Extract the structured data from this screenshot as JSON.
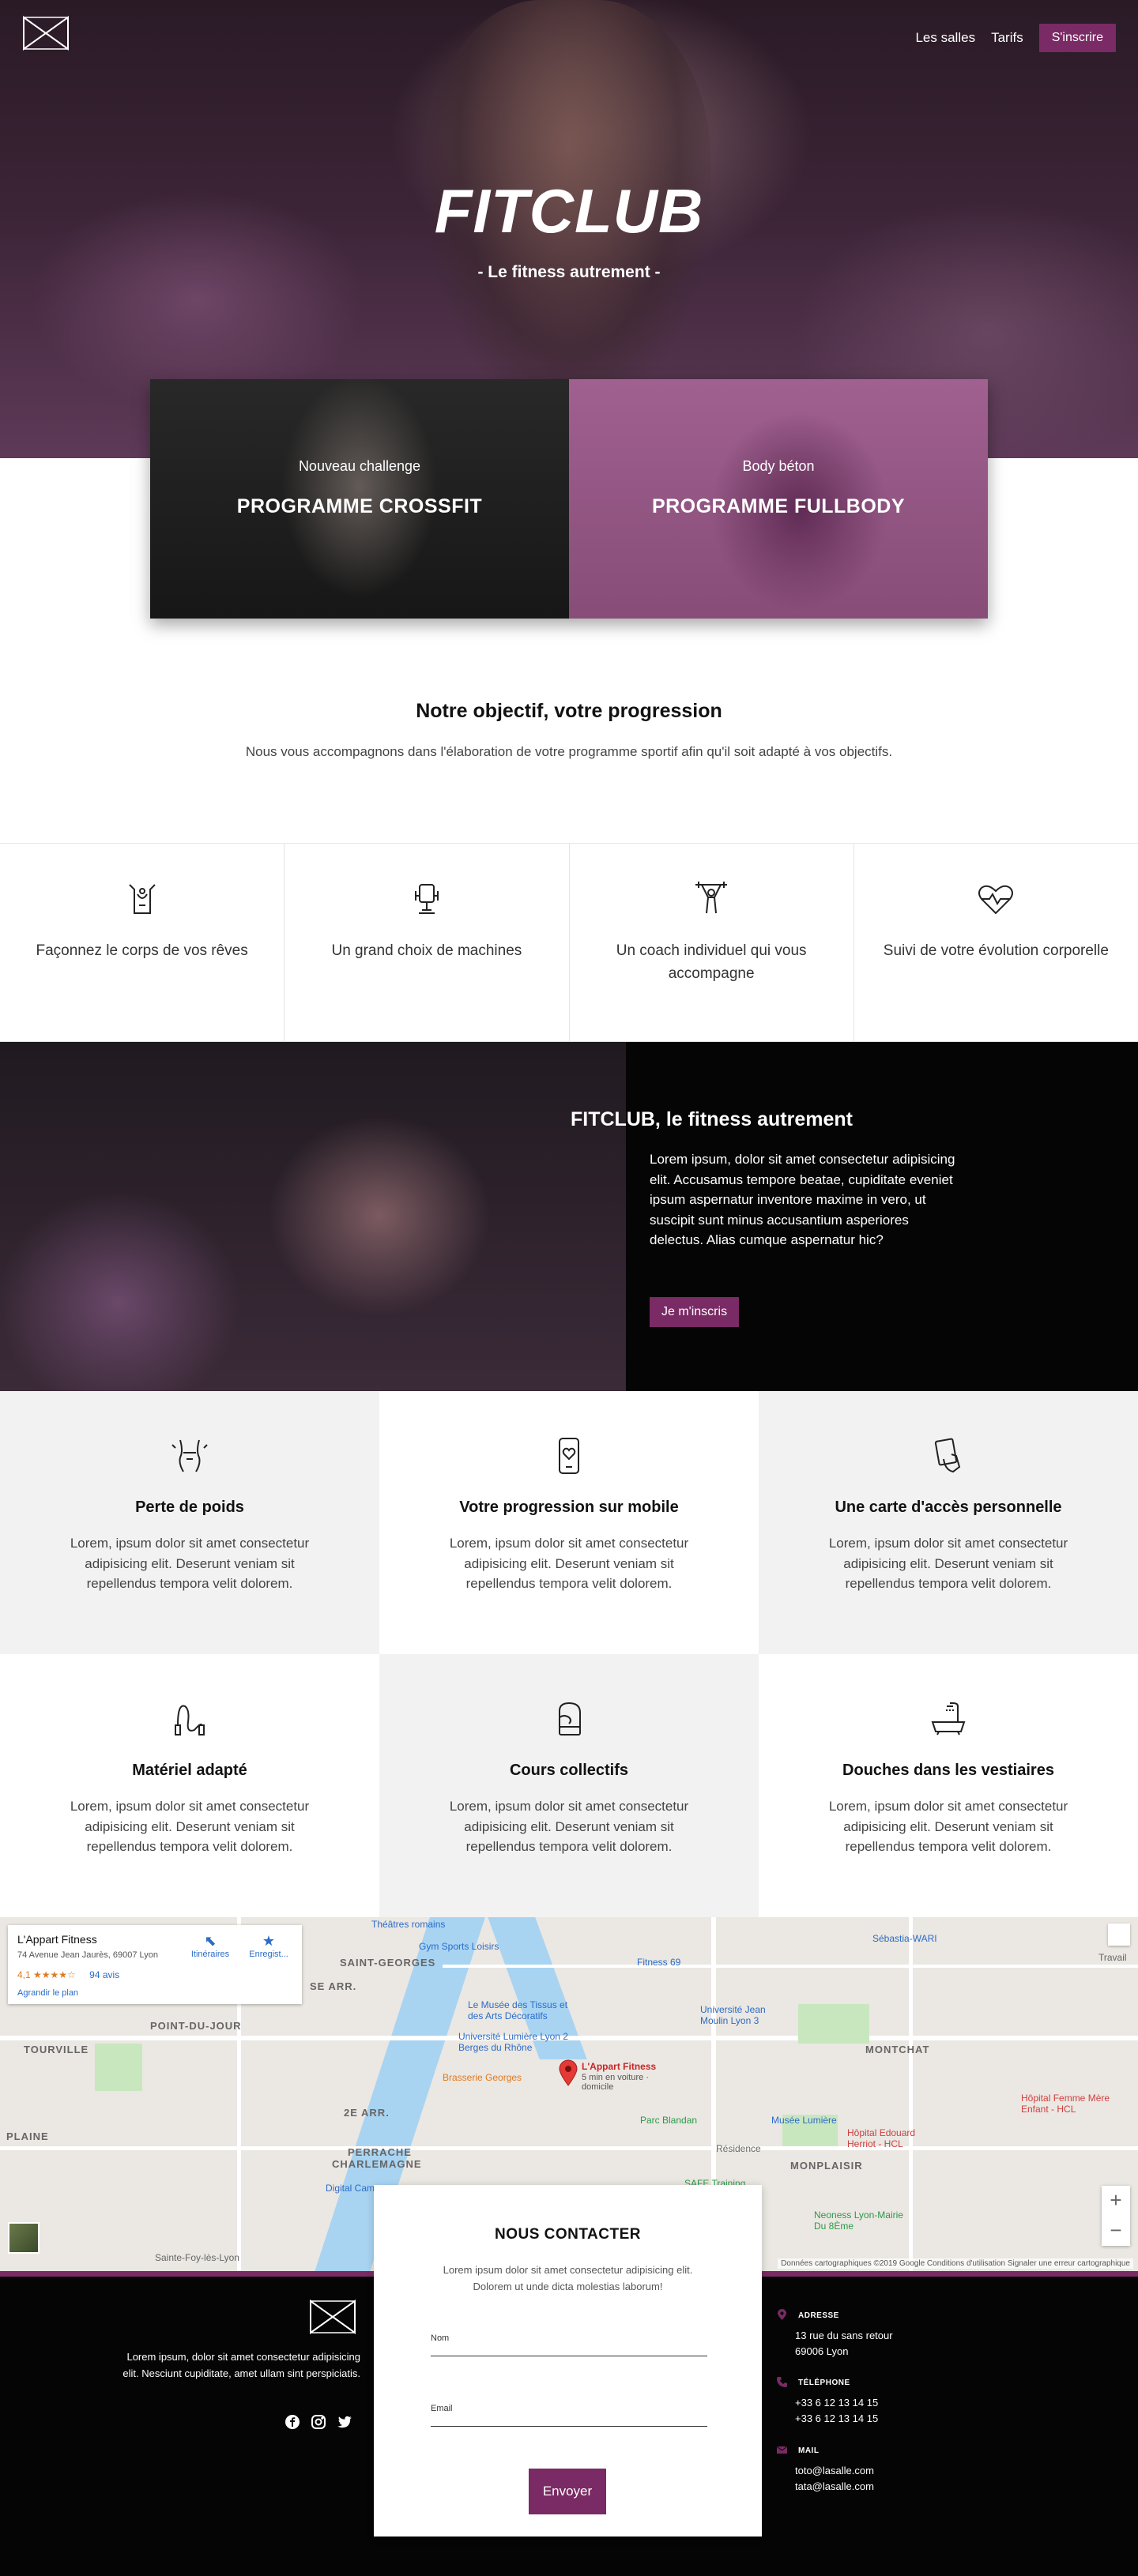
{
  "nav": {
    "items": [
      "Les salles",
      "Tarifs"
    ],
    "cta": "S'inscrire"
  },
  "hero": {
    "title": "FITCLUB",
    "subtitle": "- Le fitness autrement -"
  },
  "programs": [
    {
      "kicker": "Nouveau challenge",
      "title": "PROGRAMME CROSSFIT"
    },
    {
      "kicker": "Body béton",
      "title": "PROGRAMME FULLBODY"
    }
  ],
  "objective": {
    "title": "Notre objectif, votre progression",
    "text": "Nous vous accompagnons dans l'élaboration de votre programme sportif afin qu'il soit adapté à vos objectifs."
  },
  "features": [
    {
      "icon": "body-shape-icon",
      "text": "Façonnez le corps de vos rêves"
    },
    {
      "icon": "machine-icon",
      "text": "Un grand choix de machines"
    },
    {
      "icon": "coach-icon",
      "text": "Un coach individuel qui vous accompagne"
    },
    {
      "icon": "heartbeat-icon",
      "text": "Suivi de votre évolution corporelle"
    }
  ],
  "promo": {
    "title": "FITCLUB, le fitness autrement",
    "body": "Lorem ipsum, dolor sit amet consectetur adipisicing elit. Accusamus tempore beatae, cupiditate eveniet ipsum aspernatur inventore maxime in vero, ut suscipit sunt minus accusantium asperiores delectus. Alias cumque aspernatur hic?",
    "button": "Je m'inscris"
  },
  "services": [
    {
      "icon": "weight-loss-icon",
      "title": "Perte de poids",
      "text": "Lorem, ipsum dolor sit amet consectetur adipisicing elit. Deserunt veniam sit repellendus tempora velit dolorem."
    },
    {
      "icon": "mobile-icon",
      "title": "Votre progression sur mobile",
      "text": "Lorem, ipsum dolor sit amet consectetur adipisicing elit. Deserunt veniam sit repellendus tempora velit dolorem."
    },
    {
      "icon": "access-card-icon",
      "title": "Une carte d'accès personnelle",
      "text": "Lorem, ipsum dolor sit amet consectetur adipisicing elit. Deserunt veniam sit repellendus tempora velit dolorem."
    },
    {
      "icon": "jump-rope-icon",
      "title": "Matériel adapté",
      "text": "Lorem, ipsum dolor sit amet consectetur adipisicing elit. Deserunt veniam sit repellendus tempora velit dolorem."
    },
    {
      "icon": "boxing-glove-icon",
      "title": "Cours collectifs",
      "text": "Lorem, ipsum dolor sit amet consectetur adipisicing elit. Deserunt veniam sit repellendus tempora velit dolorem."
    },
    {
      "icon": "shower-icon",
      "title": "Douches dans les vestiaires",
      "text": "Lorem, ipsum dolor sit amet consectetur adipisicing elit. Deserunt veniam sit repellendus tempora velit dolorem."
    }
  ],
  "map": {
    "place_name": "L'Appart Fitness",
    "address": "74 Avenue Jean Jaurès, 69007 Lyon",
    "rating": "4,1",
    "stars": "★★★★☆",
    "reviews": "94 avis",
    "enlarge": "Agrandir le plan",
    "directions": "Itinéraires",
    "save": "Enregist...",
    "pin_label": "L'Appart Fitness",
    "pin_sub": "5 min en voiture · domicile",
    "labels": [
      "SAINT-GEORGES",
      "SE ARR.",
      "POINT-DU-JOUR",
      "TOURVILLE",
      "2E ARR.",
      "PERRACHE",
      "CHARLEMAGNE",
      "MONTCHAT",
      "MONPLAISIR",
      "PLAINE"
    ],
    "poi": [
      "Théâtres romains",
      "Gym Sports Loisirs",
      "Fitness 69",
      "Le Musée des Tissus et des Arts Décoratifs",
      "Université Lumière Lyon 2 Berges du Rhône",
      "Brasserie Georges",
      "Université Jean Moulin Lyon 3",
      "Parc Blandan",
      "Musée Lumière",
      "Hôpital Edouard Herriot - HCL",
      "Hôpital Femme Mère Enfant - HCL",
      "Neoness Lyon-Mairie Du 8Ème",
      "SAFE Training",
      "Sébastia-WARI",
      "Digital Campus",
      "Sainte-Foy-lès-Lyon",
      "Résidence",
      "Travail"
    ],
    "zoom_in": "+",
    "zoom_out": "−",
    "credit": "Données cartographiques ©2019 Google   Conditions d'utilisation   Signaler une erreur cartographique"
  },
  "contact": {
    "title": "NOUS CONTACTER",
    "text": "Lorem ipsum dolor sit amet consectetur adipisicing elit. Dolorem ut unde dicta molestias laborum!",
    "name_label": "Nom",
    "email_label": "Email",
    "name_value": "",
    "email_value": "",
    "button": "Envoyer"
  },
  "footer": {
    "about": "Lorem ipsum, dolor sit amet consectetur adipisicing elit. Nesciunt cupiditate, amet ullam sint perspiciatis.",
    "social": [
      "facebook-icon",
      "instagram-icon",
      "twitter-icon"
    ],
    "address_title": "ADRESSE",
    "address": [
      "13 rue du sans retour",
      "69006 Lyon"
    ],
    "phone_title": "TÉLÉPHONE",
    "phones": [
      "+33 6 12 13 14 15",
      "+33 6 12 13 14 15"
    ],
    "mail_title": "MAIL",
    "mails": [
      "toto@lasalle.com",
      "tata@lasalle.com"
    ]
  },
  "colors": {
    "accent": "#7a2a64",
    "dark": "#050505",
    "grey": "#f2f2f2"
  }
}
